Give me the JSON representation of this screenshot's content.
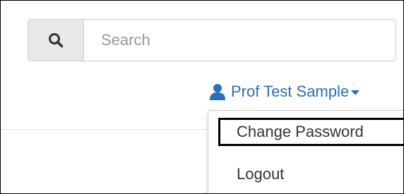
{
  "search": {
    "placeholder": "Search",
    "icon": "magnifier-icon"
  },
  "user_menu": {
    "name": "Prof Test Sample",
    "icon": "person-icon",
    "link_color": "#2a6fb8"
  },
  "dropdown": {
    "items": [
      {
        "label": "Change Password",
        "focused": true
      },
      {
        "label": "Logout",
        "focused": false
      }
    ]
  }
}
